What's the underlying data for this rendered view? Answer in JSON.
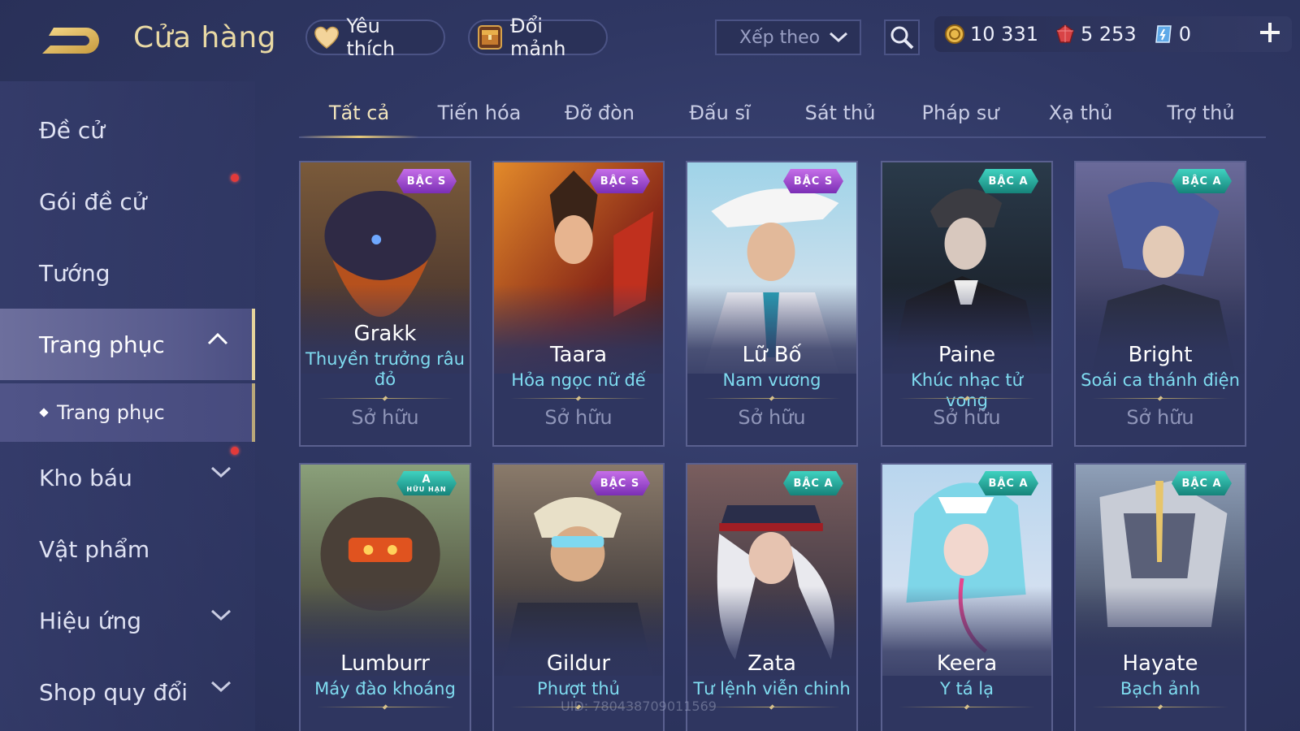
{
  "header": {
    "title": "Cửa hàng",
    "favorites_label": "Yêu thích",
    "shard_label": "Đổi mảnh",
    "sort_label": "Xếp theo",
    "currencies": [
      {
        "icon": "gold-coin-icon",
        "value": "10 331"
      },
      {
        "icon": "red-gem-icon",
        "value": "5 253"
      },
      {
        "icon": "blue-voucher-icon",
        "value": "0"
      }
    ]
  },
  "sidebar": {
    "items": [
      {
        "label": "Đề cử"
      },
      {
        "label": "Gói đề cử"
      },
      {
        "label": "Tướng"
      },
      {
        "label": "Trang phục"
      },
      {
        "label": "Kho báu"
      },
      {
        "label": "Vật phẩm"
      },
      {
        "label": "Hiệu ứng"
      },
      {
        "label": "Shop quy đổi"
      }
    ],
    "sub_item": "Trang phục"
  },
  "tabs": [
    "Tất cả",
    "Tiến hóa",
    "Đỡ đòn",
    "Đấu sĩ",
    "Sát thủ",
    "Pháp sư",
    "Xạ thủ",
    "Trợ thủ"
  ],
  "cards": [
    {
      "hero": "Grakk",
      "skin": "Thuyền trưởng râu đỏ",
      "badge": "BẬC S",
      "status": "Sở hữu",
      "tier": "s"
    },
    {
      "hero": "Taara",
      "skin": "Hỏa ngọc nữ đế",
      "badge": "BẬC S",
      "status": "Sở hữu",
      "tier": "s"
    },
    {
      "hero": "Lữ Bố",
      "skin": "Nam vương",
      "badge": "BẬC S",
      "status": "Sở hữu",
      "tier": "s"
    },
    {
      "hero": "Paine",
      "skin": "Khúc nhạc tử vong",
      "badge": "BẬC A",
      "status": "Sở hữu",
      "tier": "a"
    },
    {
      "hero": "Bright",
      "skin": "Soái ca thánh điện",
      "badge": "BẬC A",
      "status": "Sở hữu",
      "tier": "a"
    },
    {
      "hero": "Lumburr",
      "skin": "Máy đào khoáng",
      "badge": "A",
      "badge_sub": "HỮU HẠN",
      "tier": "a"
    },
    {
      "hero": "Gildur",
      "skin": "Phượt thủ",
      "badge": "BẬC S",
      "tier": "s"
    },
    {
      "hero": "Zata",
      "skin": "Tư lệnh viễn chinh",
      "badge": "BẬC A",
      "tier": "a"
    },
    {
      "hero": "Keera",
      "skin": "Y tá lạ",
      "badge": "BẬC A",
      "tier": "a"
    },
    {
      "hero": "Hayate",
      "skin": "Bạch ảnh",
      "badge": "BẬC A",
      "tier": "a"
    }
  ],
  "uid_text": "UID: 780438709011569"
}
